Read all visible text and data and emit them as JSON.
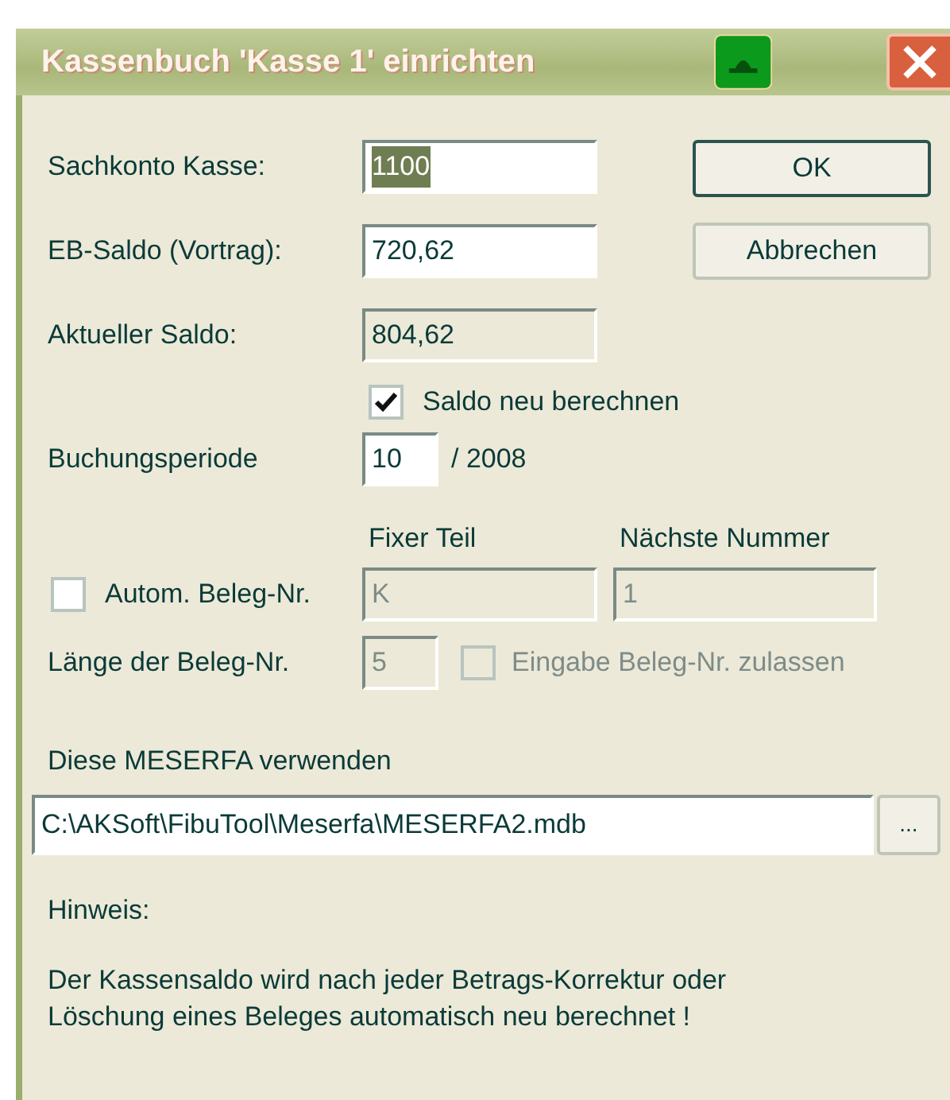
{
  "window": {
    "title": "Kassenbuch 'Kasse 1' einrichten"
  },
  "fields": [
    {
      "label": "Sachkonto Kasse:",
      "value": "1100",
      "text_selected": true,
      "readonly": false
    },
    {
      "label": "EB-Saldo (Vortrag):",
      "value": "720,62",
      "text_selected": false,
      "readonly": false
    },
    {
      "label": "Aktueller Saldo:",
      "value": "804,62",
      "text_selected": false,
      "readonly": true
    }
  ],
  "buttons": [
    {
      "label": "OK",
      "default": true
    },
    {
      "label": "Abbrechen",
      "default": false
    }
  ],
  "recalc_checkbox": {
    "label": "Saldo neu berechnen",
    "checked": true
  },
  "period": {
    "label": "Buchungsperiode",
    "value": "10",
    "year": "/ 2008"
  },
  "receipt_numbers": {
    "headings": [
      "Fixer Teil",
      "Nächste Nummer"
    ],
    "auto_checkbox": {
      "label": "Autom. Beleg-Nr.",
      "checked": false
    },
    "fixed_part": {
      "value": "K",
      "disabled": true
    },
    "next_number": {
      "value": "1",
      "disabled": true
    },
    "length": {
      "label": "Länge der Beleg-Nr.",
      "value": "5",
      "disabled": true
    },
    "allow_input_checkbox": {
      "label": "Eingabe Beleg-Nr. zulassen",
      "checked": false,
      "disabled": true
    }
  },
  "meserfa": {
    "label": "Diese MESERFA verwenden",
    "path": "C:\\AKSoft\\FibuTool\\Meserfa\\MESERFA2.mdb",
    "browse_button": "..."
  },
  "note": {
    "heading": "Hinweis:",
    "text": "Der Kassensaldo wird nach jeder Betrags-Korrektur oder Löschung eines Beleges automatisch neu berechnet !"
  }
}
